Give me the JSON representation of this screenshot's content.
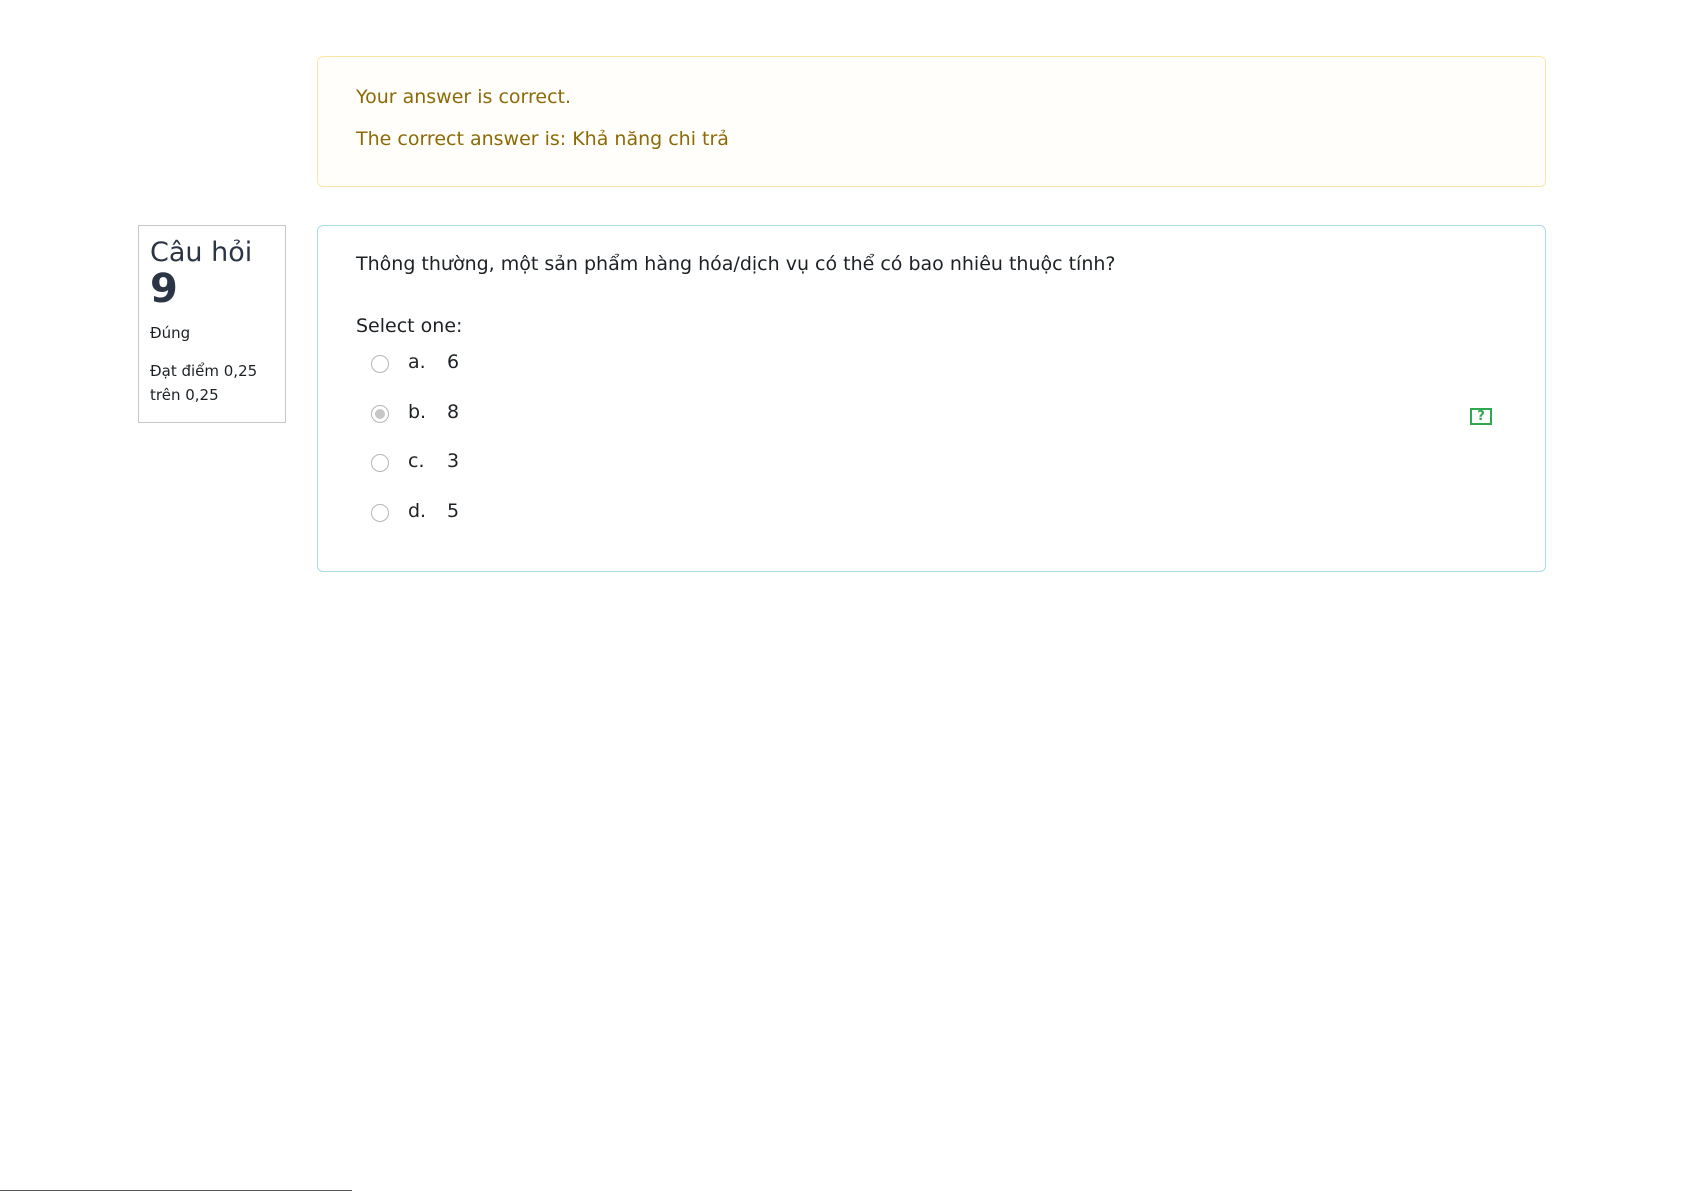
{
  "feedback": {
    "result_text": "Your answer is correct.",
    "correct_answer_text": "The correct answer is: Khả năng chi trả"
  },
  "question_info": {
    "label": "Câu hỏi",
    "number": "9",
    "state": "Đúng",
    "grade": "Đạt điểm 0,25 trên 0,25"
  },
  "question": {
    "text": "Thông thường, một sản phẩm hàng hóa/dịch vụ có thể có bao nhiêu thuộc tính?",
    "prompt": "Select one:",
    "selected_option": "b",
    "options": [
      {
        "letter": "a.",
        "value": "6"
      },
      {
        "letter": "b.",
        "value": "8"
      },
      {
        "letter": "c.",
        "value": "3"
      },
      {
        "letter": "d.",
        "value": "5"
      }
    ]
  },
  "colors": {
    "feedback_text": "#8c6a06",
    "feedback_border": "#fbe6a8",
    "question_border": "#a9dbe8",
    "help_icon": "#2fa84f"
  },
  "icons": {
    "help": "help-icon"
  }
}
